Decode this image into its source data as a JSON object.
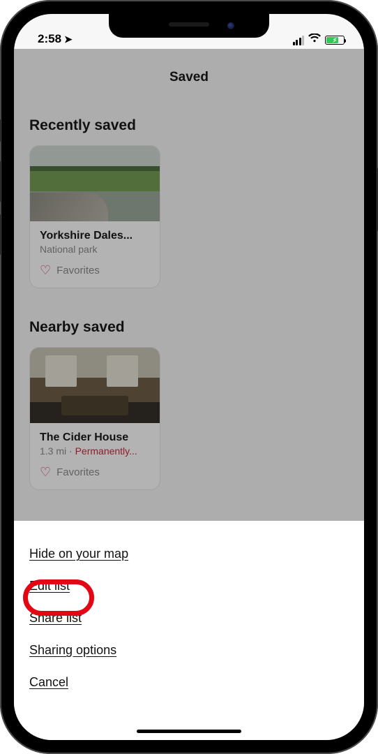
{
  "status": {
    "time": "2:58",
    "location_icon": "➤"
  },
  "nav": {
    "title": "Saved"
  },
  "sections": {
    "recent": {
      "title": "Recently saved",
      "card": {
        "name": "Yorkshire Dales...",
        "subtitle": "National park",
        "fav_label": "Favorites"
      }
    },
    "nearby": {
      "title": "Nearby saved",
      "card": {
        "name": "The Cider House",
        "distance": "1.3 mi",
        "sep": " · ",
        "status": "Permanently...",
        "fav_label": "Favorites"
      }
    }
  },
  "sheet": {
    "hide": "Hide on your map",
    "edit": "Edit list",
    "share": "Share list",
    "options": "Sharing options",
    "cancel": "Cancel"
  }
}
